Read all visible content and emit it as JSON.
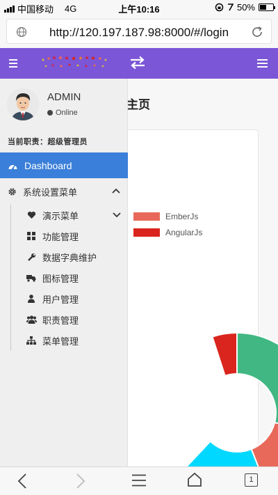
{
  "status_bar": {
    "carrier": "中国移动",
    "network": "4G",
    "time": "上午10:16",
    "battery": "50%",
    "battery_level": 0.5
  },
  "browser": {
    "url": "http://120.197.187.98:8000/#/login",
    "tab_count": "1",
    "icons": [
      "globe-icon",
      "reload-icon",
      "back-icon",
      "forward-icon",
      "menu-icon",
      "home-icon",
      "tabs-icon"
    ]
  },
  "header": {
    "colors": {
      "header_bg": "#7b56d6",
      "accent": "#3a7fd9"
    },
    "icons": [
      "sidebar-toggle-icon",
      "logo",
      "swap-icon",
      "right-menu-icon"
    ]
  },
  "user": {
    "name": "ADMIN",
    "status": "Online",
    "role": "当前职责：超级管理员"
  },
  "sidebar": {
    "active": {
      "label": "Dashboard",
      "icon": "dashboard-icon"
    },
    "group": {
      "label": "系统设置菜单",
      "icon": "gear-icon",
      "expanded": true
    },
    "items": [
      {
        "label": "演示菜单",
        "icon": "heart-icon",
        "has_children": true
      },
      {
        "label": "功能管理",
        "icon": "grid-icon"
      },
      {
        "label": "数据字典维护",
        "icon": "wrench-icon"
      },
      {
        "label": "图标管理",
        "icon": "truck-icon"
      },
      {
        "label": "用户管理",
        "icon": "user-icon"
      },
      {
        "label": "职责管理",
        "icon": "users-icon"
      },
      {
        "label": "菜单管理",
        "icon": "sitemap-icon"
      }
    ]
  },
  "main": {
    "title_visible": "主页"
  },
  "chart_data": {
    "type": "pie",
    "legend": [
      {
        "name": "EmberJs",
        "color": "#e8695a"
      },
      {
        "name": "AngularJs",
        "color": "#d9251d"
      }
    ],
    "visible_slices": [
      {
        "color": "#d9251d",
        "value": 0.05
      },
      {
        "color": "#41b883",
        "value": 0.29
      },
      {
        "color": "#e8695a",
        "value": 0.15
      },
      {
        "color": "#00d8ff",
        "value": 0.18
      }
    ],
    "note_colors": {
      "vue": "#41b883",
      "ember": "#e8695a",
      "angular": "#d9251d",
      "react": "#00d8ff"
    }
  }
}
